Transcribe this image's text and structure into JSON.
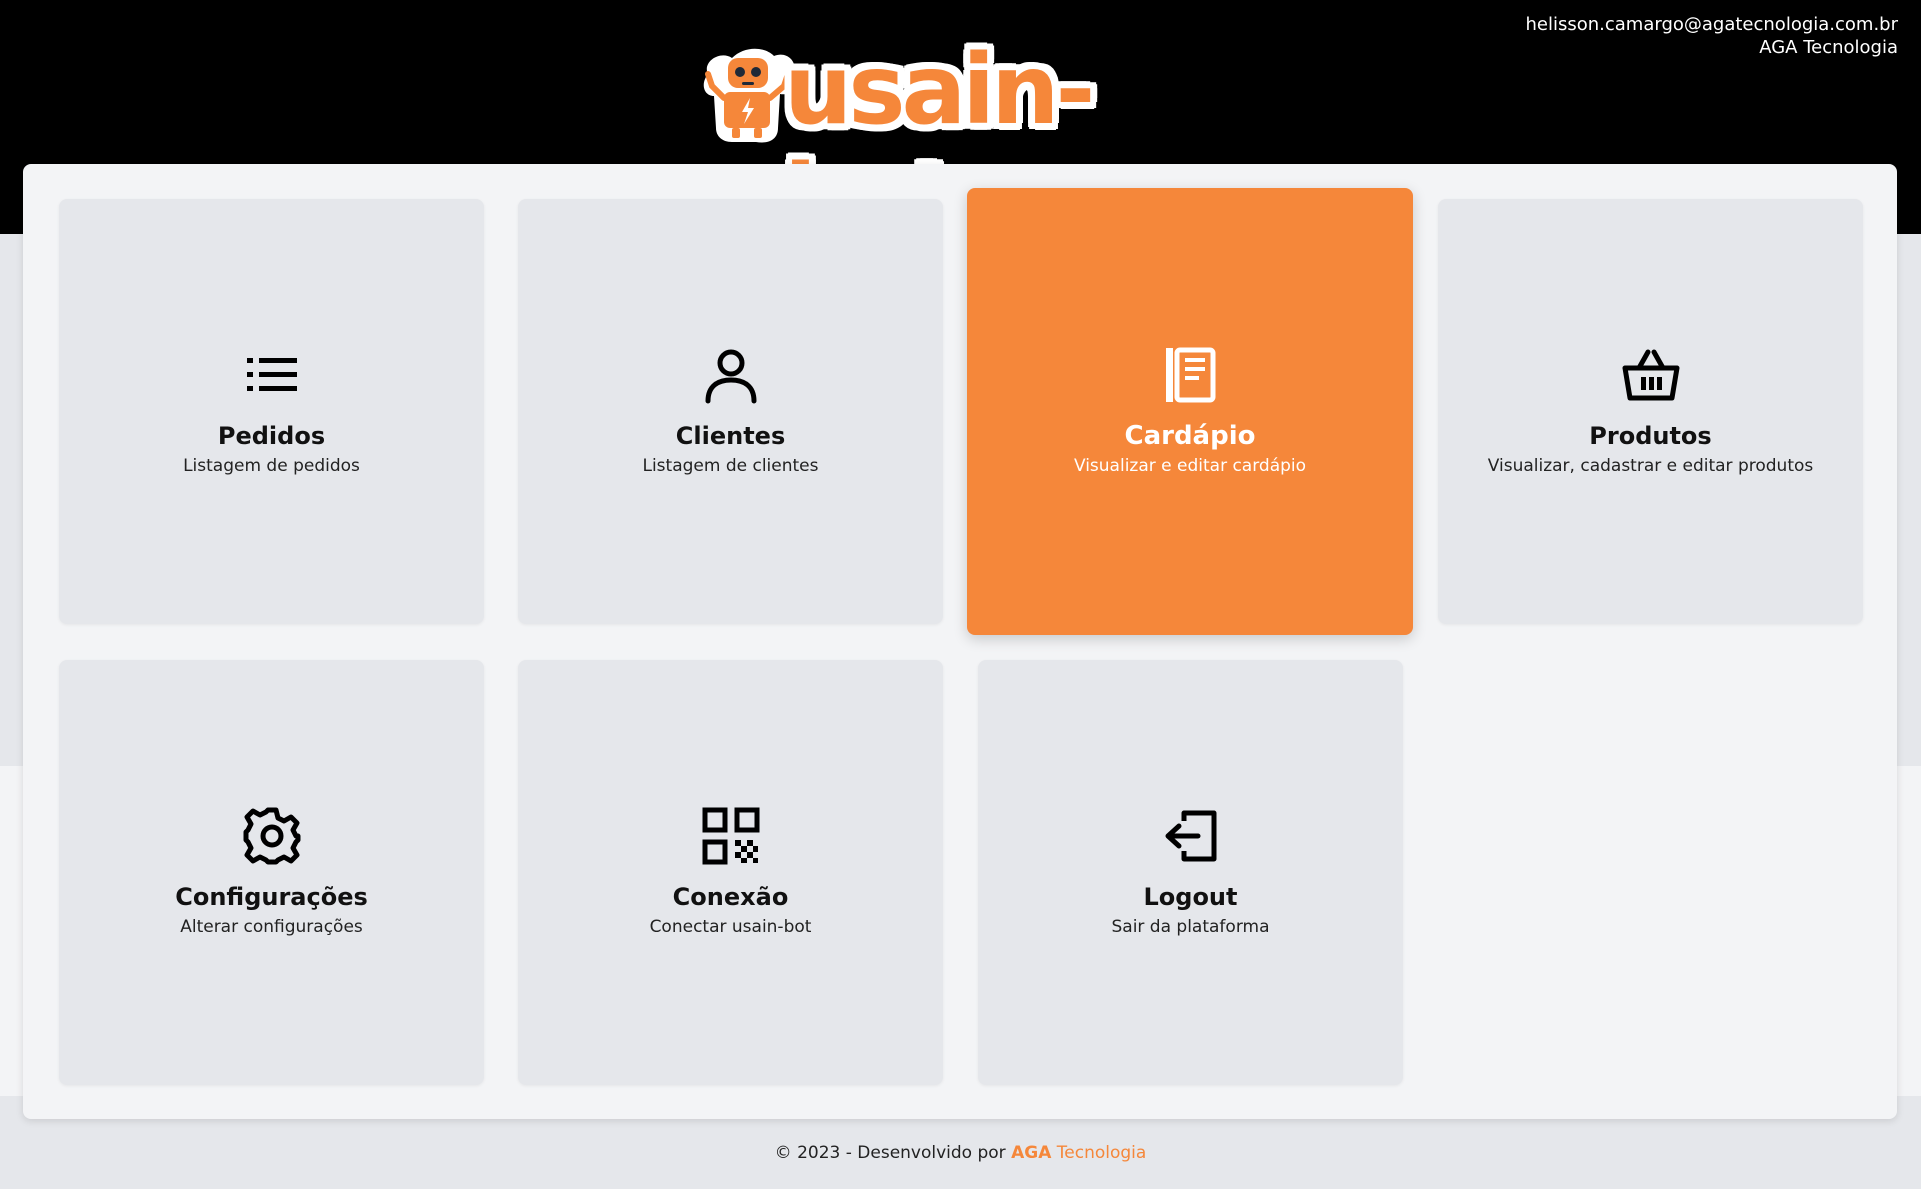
{
  "header": {
    "user_email": "helisson.camargo@agatecnologia.com.br",
    "company": "AGA Tecnologia",
    "logo_text": "usain-bot"
  },
  "colors": {
    "accent": "#f5873a",
    "header_bg": "#000000",
    "panel_bg": "#f3f4f6",
    "card_bg": "#e5e7eb"
  },
  "cards": [
    {
      "title": "Pedidos",
      "subtitle": "Listagem de pedidos",
      "icon": "list-icon"
    },
    {
      "title": "Clientes",
      "subtitle": "Listagem de clientes",
      "icon": "user-icon"
    },
    {
      "title": "Cardápio",
      "subtitle": "Visualizar e editar cardápio",
      "icon": "menu-book-icon",
      "active": true
    },
    {
      "title": "Produtos",
      "subtitle": "Visualizar, cadastrar e editar produtos",
      "icon": "basket-icon"
    },
    {
      "title": "Configurações",
      "subtitle": "Alterar configurações",
      "icon": "gear-icon"
    },
    {
      "title": "Conexão",
      "subtitle": "Conectar usain-bot",
      "icon": "qr-code-icon"
    },
    {
      "title": "Logout",
      "subtitle": "Sair da plataforma",
      "icon": "logout-icon"
    }
  ],
  "footer": {
    "prefix": "© 2023 - Desenvolvido por",
    "brand_bold": "AGA",
    "brand_rest": "Tecnologia"
  }
}
